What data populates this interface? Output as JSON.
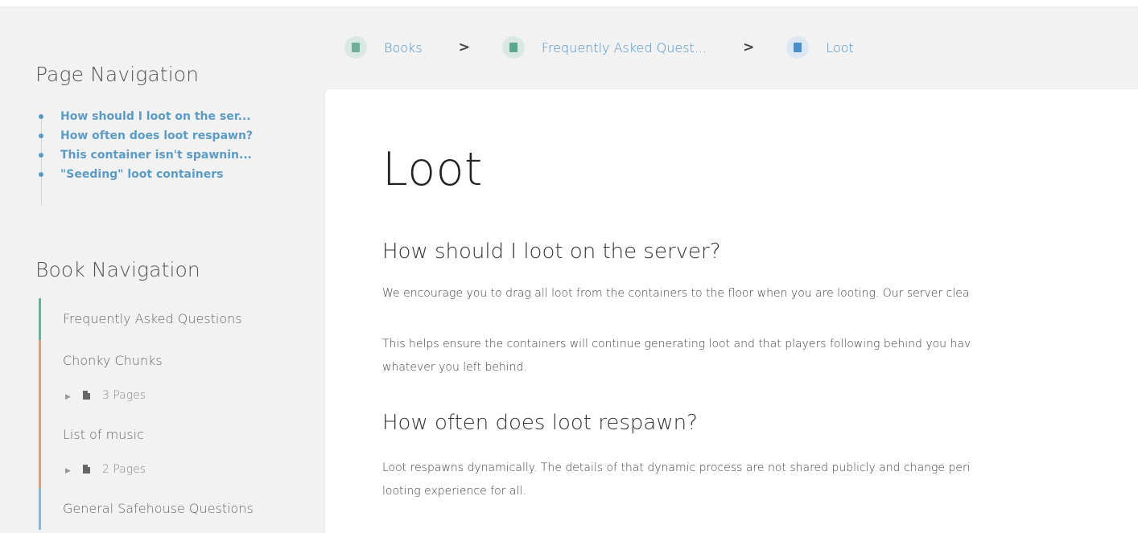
{
  "sidebar": {
    "page_nav_heading": "Page Navigation",
    "page_nav_items": [
      "How should I loot on the ser...",
      "How often does loot respawn?",
      "This container isn't spawnin...",
      "\"Seeding\" loot containers"
    ],
    "book_nav_heading": "Book Navigation",
    "books": [
      {
        "title": "Frequently Asked Questions",
        "color": "#6fae9b",
        "pages": ""
      },
      {
        "title": "Chonky Chunks",
        "color": "#d2a283",
        "pages": "3 Pages"
      },
      {
        "title": "List of music",
        "color": "#d2a283",
        "pages": "2 Pages"
      },
      {
        "title": "General Safehouse Questions",
        "color": "#8fb4cf",
        "pages": ""
      }
    ]
  },
  "breadcrumb": {
    "items": [
      {
        "label": "Books",
        "icon": "books-icon",
        "bg": "#d9e8e2",
        "fg": "#6fae9b"
      },
      {
        "label": "Frequently Asked Quest...",
        "icon": "book-icon",
        "bg": "#d9e8e2",
        "fg": "#5ba88e"
      },
      {
        "label": "Loot",
        "icon": "page-icon",
        "bg": "#dbe7f2",
        "fg": "#4a90c6"
      }
    ],
    "separator": ">"
  },
  "content": {
    "title": "Loot",
    "sections": [
      {
        "heading": "How should I loot on the server?",
        "paragraphs": [
          "We encourage you to drag all loot from the containers to the floor when you are looting. Our server clea",
          "This helps ensure the containers will continue generating loot and that players following behind you hav",
          "whatever you left behind."
        ]
      },
      {
        "heading": "How often does loot respawn?",
        "paragraphs": [
          "Loot respawns dynamically. The details of that dynamic process are not shared publicly and change peri",
          "looting experience for all."
        ]
      }
    ]
  },
  "colors": {
    "accent": "#5b9bc6",
    "link": "#4a90c6",
    "page_bg": "#f2f2f2",
    "card_bg": "#ffffff"
  }
}
